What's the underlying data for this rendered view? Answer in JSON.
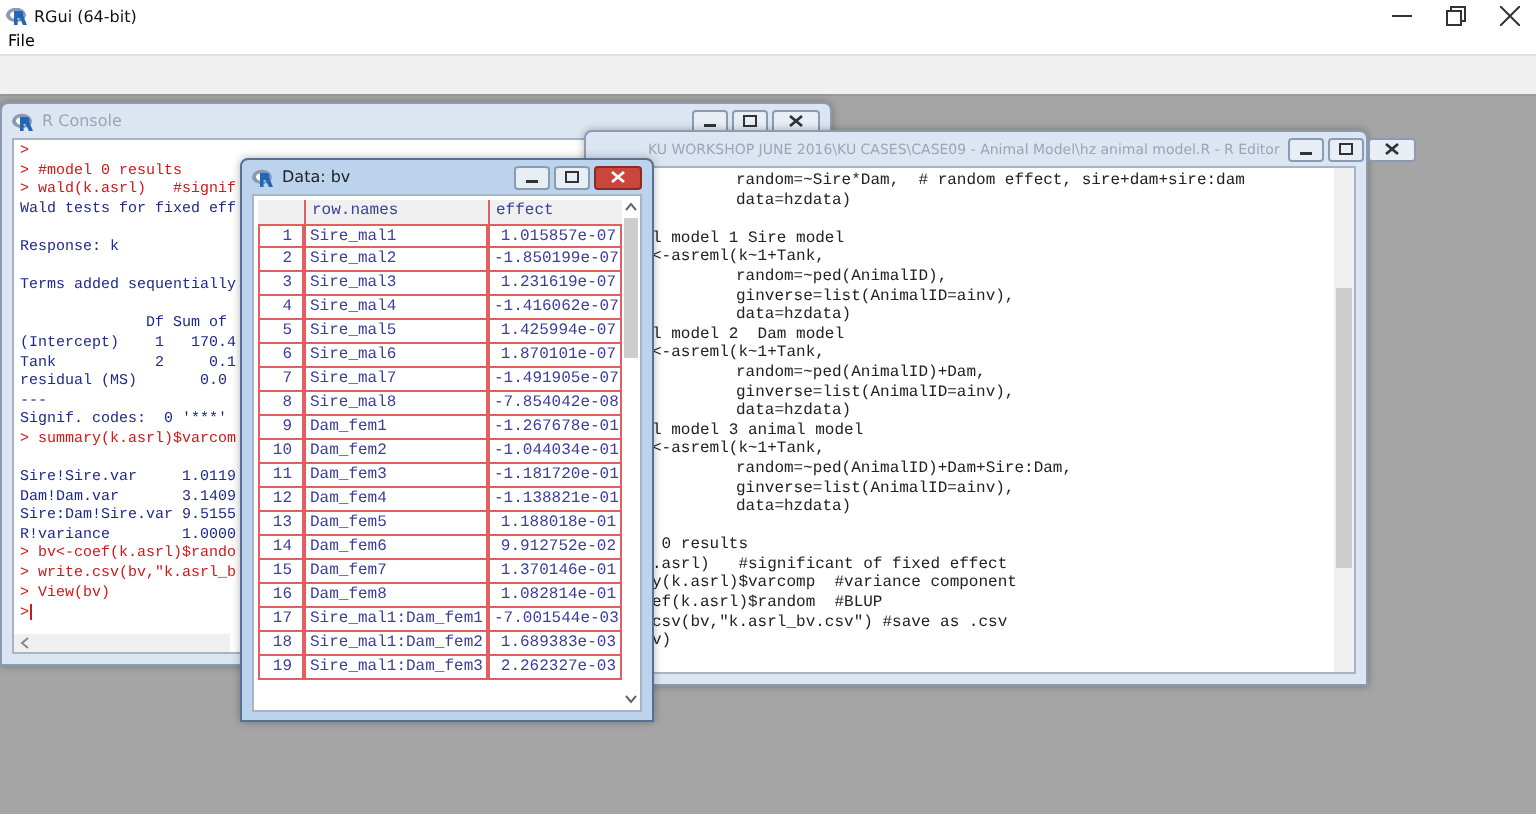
{
  "app": {
    "title": "RGui (64-bit)",
    "menu": [
      "File"
    ]
  },
  "console": {
    "title": "R Console",
    "active": false,
    "lines": [
      {
        "kind": "input",
        "text": ">"
      },
      {
        "kind": "input",
        "text": "> #model 0 results"
      },
      {
        "kind": "input",
        "text": "> wald(k.asrl)   #signif"
      },
      {
        "kind": "output",
        "text": "Wald tests for fixed eff"
      },
      {
        "kind": "blank"
      },
      {
        "kind": "output",
        "text": "Response: k"
      },
      {
        "kind": "blank"
      },
      {
        "kind": "output",
        "text": "Terms added sequentially"
      },
      {
        "kind": "blank"
      },
      {
        "kind": "output",
        "text": "              Df Sum of"
      },
      {
        "kind": "output",
        "text": "(Intercept)    1   170.4"
      },
      {
        "kind": "output",
        "text": "Tank           2     0.1"
      },
      {
        "kind": "output",
        "text": "residual (MS)       0.0"
      },
      {
        "kind": "output",
        "text": "---"
      },
      {
        "kind": "output",
        "text": "Signif. codes:  0 '***'"
      },
      {
        "kind": "input",
        "text": "> summary(k.asrl)$varcom"
      },
      {
        "kind": "blank"
      },
      {
        "kind": "output",
        "text": "Sire!Sire.var     1.0119"
      },
      {
        "kind": "output",
        "text": "Dam!Dam.var       3.1409"
      },
      {
        "kind": "output",
        "text": "Sire:Dam!Sire.var 9.5155"
      },
      {
        "kind": "output",
        "text": "R!variance        1.0000"
      },
      {
        "kind": "input",
        "text": "> bv<-coef(k.asrl)$rando"
      },
      {
        "kind": "input",
        "text": "> write.csv(bv,\"k.asrl_b"
      },
      {
        "kind": "input",
        "text": "> View(bv)"
      },
      {
        "kind": "prompt",
        "text": ">"
      }
    ]
  },
  "editor": {
    "title": "KU WORKSHOP JUNE 2016\\KU CASES\\CASE09 - Animal Model\\hz animal model.R - R Editor",
    "active": false,
    "lines": [
      {
        "kind": "arg",
        "text": "random=~Sire*Dam,  # random effect, sire+dam+sire:dam"
      },
      {
        "kind": "arg",
        "text": "data=hzdata)"
      },
      {
        "kind": "blank"
      },
      {
        "kind": "code",
        "text": "l model 1 Sire model"
      },
      {
        "kind": "code",
        "text": "<-asreml(k~1+Tank,"
      },
      {
        "kind": "arg",
        "text": "random=~ped(AnimalID),"
      },
      {
        "kind": "arg",
        "text": "ginverse=list(AnimalID=ainv),"
      },
      {
        "kind": "arg",
        "text": "data=hzdata)"
      },
      {
        "kind": "code",
        "text": "l model 2  Dam model"
      },
      {
        "kind": "code",
        "text": "<-asreml(k~1+Tank,"
      },
      {
        "kind": "arg",
        "text": "random=~ped(AnimalID)+Dam,"
      },
      {
        "kind": "arg",
        "text": "ginverse=list(AnimalID=ainv),"
      },
      {
        "kind": "arg",
        "text": "data=hzdata)"
      },
      {
        "kind": "code",
        "text": "l model 3 animal model"
      },
      {
        "kind": "code",
        "text": "<-asreml(k~1+Tank,"
      },
      {
        "kind": "arg",
        "text": "random=~ped(AnimalID)+Dam+Sire:Dam,"
      },
      {
        "kind": "arg",
        "text": "ginverse=list(AnimalID=ainv),"
      },
      {
        "kind": "arg",
        "text": "data=hzdata)"
      },
      {
        "kind": "blank"
      },
      {
        "kind": "code",
        "text": " 0 results"
      },
      {
        "kind": "code",
        "text": ".asrl)   #significant of fixed effect"
      },
      {
        "kind": "code",
        "text": "y(k.asrl)$varcomp  #variance component"
      },
      {
        "kind": "code",
        "text": "ef(k.asrl)$random  #BLUP"
      },
      {
        "kind": "code",
        "text": "csv(bv,\"k.asrl_bv.csv\") #save as .csv"
      },
      {
        "kind": "code",
        "text": "v)"
      }
    ]
  },
  "data_viewer": {
    "title": "Data: bv",
    "active": true,
    "columns": [
      "row.names",
      "effect"
    ],
    "rows": [
      {
        "index": "1",
        "name": "Sire_mal1",
        "effect": "1.015857e-07"
      },
      {
        "index": "2",
        "name": "Sire_mal2",
        "effect": "-1.850199e-07"
      },
      {
        "index": "3",
        "name": "Sire_mal3",
        "effect": "1.231619e-07"
      },
      {
        "index": "4",
        "name": "Sire_mal4",
        "effect": "-1.416062e-07"
      },
      {
        "index": "5",
        "name": "Sire_mal5",
        "effect": "1.425994e-07"
      },
      {
        "index": "6",
        "name": "Sire_mal6",
        "effect": "1.870101e-07"
      },
      {
        "index": "7",
        "name": "Sire_mal7",
        "effect": "-1.491905e-07"
      },
      {
        "index": "8",
        "name": "Sire_mal8",
        "effect": "-7.854042e-08"
      },
      {
        "index": "9",
        "name": "Dam_fem1",
        "effect": "-1.267678e-01"
      },
      {
        "index": "10",
        "name": "Dam_fem2",
        "effect": "-1.044034e-01"
      },
      {
        "index": "11",
        "name": "Dam_fem3",
        "effect": "-1.181720e-01"
      },
      {
        "index": "12",
        "name": "Dam_fem4",
        "effect": "-1.138821e-01"
      },
      {
        "index": "13",
        "name": "Dam_fem5",
        "effect": "1.188018e-01"
      },
      {
        "index": "14",
        "name": "Dam_fem6",
        "effect": "9.912752e-02"
      },
      {
        "index": "15",
        "name": "Dam_fem7",
        "effect": "1.370146e-01"
      },
      {
        "index": "16",
        "name": "Dam_fem8",
        "effect": "1.082814e-01"
      },
      {
        "index": "17",
        "name": "Sire_mal1:Dam_fem1",
        "effect": "-7.001544e-03"
      },
      {
        "index": "18",
        "name": "Sire_mal1:Dam_fem2",
        "effect": "1.689383e-03"
      },
      {
        "index": "19",
        "name": "Sire_mal1:Dam_fem3",
        "effect": "2.262327e-03"
      }
    ]
  }
}
